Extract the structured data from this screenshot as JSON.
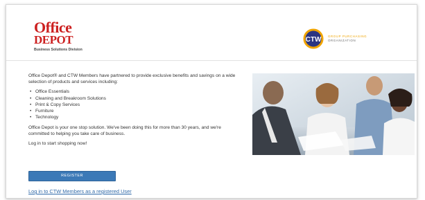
{
  "header": {
    "od_logo_line1": "Office",
    "od_logo_line2": "DEPOT",
    "od_logo_sub": "Business Solutions Division",
    "ctw_logo_text_line1": "GROUP PURCHASING",
    "ctw_logo_text_line2": "ORGANIZATION",
    "ctw_logo_mark": "CTW"
  },
  "content": {
    "intro": "Office Depot® and CTW Members have partnered to provide exclusive benefits and savings on a wide selection of products and services including:",
    "items": [
      "Office Essentials",
      "Cleaning and Breakroom Solutions",
      "Print & Copy Services",
      "Furniture",
      "Technology"
    ],
    "one_stop": "Office Depot is your one stop solution. We've been doing this for more than 30 years, and we're committed to helping you take care of business.",
    "login_prompt": "Log in to start shopping now!"
  },
  "actions": {
    "register_label": "REGISTER",
    "login_link": "Log in to CTW Members as a registered User"
  },
  "colors": {
    "brand_red": "#cc1f1f",
    "button_blue": "#3b79b7",
    "link_blue": "#2e68a8",
    "ctw_accent": "#f0a400"
  }
}
